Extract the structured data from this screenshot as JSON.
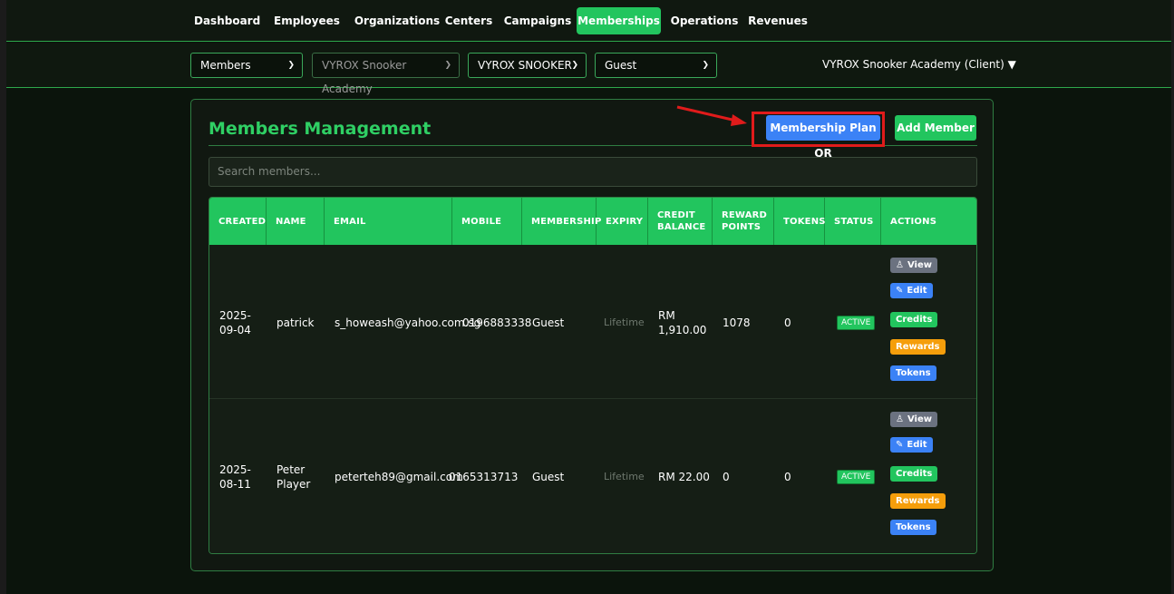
{
  "nav": {
    "tabs": [
      {
        "label": "Dashboard"
      },
      {
        "label": "Employees"
      },
      {
        "label": "Organizations"
      },
      {
        "label": "Centers"
      },
      {
        "label": "Campaigns"
      },
      {
        "label": "Memberships",
        "active": true
      },
      {
        "label": "Operations"
      },
      {
        "label": "Revenues"
      }
    ]
  },
  "filters": {
    "section": "Members",
    "organization": "VYROX Snooker Academy",
    "center": "VYROX SNOOKER",
    "membership": "Guest",
    "client_label": "VYROX Snooker Academy (Client) ▼"
  },
  "page": {
    "title": "Members Management",
    "qr_button": "Membership Plan QR",
    "add_button": "Add Member",
    "search_placeholder": "Search members..."
  },
  "table": {
    "headers": [
      "CREATED",
      "NAME",
      "EMAIL",
      "MOBILE",
      "MEMBERSHIP",
      "EXPIRY",
      "CREDIT BALANCE",
      "REWARD POINTS",
      "TOKENS",
      "STATUS",
      "ACTIONS"
    ],
    "rows": [
      {
        "created": "2025-09-04",
        "name": "patrick",
        "email": "s_howeash@yahoo.com.sg",
        "mobile": "0196883338",
        "membership": "Guest",
        "expiry": "Lifetime",
        "credit_balance": "RM 1,910.00",
        "reward_points": "1078",
        "tokens": "0",
        "status": "ACTIVE"
      },
      {
        "created": "2025-08-11",
        "name": "Peter Player",
        "email": "peterteh89@gmail.com",
        "mobile": "0165313713",
        "membership": "Guest",
        "expiry": "Lifetime",
        "credit_balance": "RM 22.00",
        "reward_points": "0",
        "tokens": "0",
        "status": "ACTIVE"
      }
    ],
    "actions": {
      "view": "View",
      "edit": "Edit",
      "credits": "Credits",
      "rewards": "Rewards",
      "tokens": "Tokens"
    }
  },
  "colors": {
    "accent": "#22c55e",
    "blue": "#3b82f6",
    "amber": "#f59e0b",
    "highlight": "#e01b1b"
  }
}
